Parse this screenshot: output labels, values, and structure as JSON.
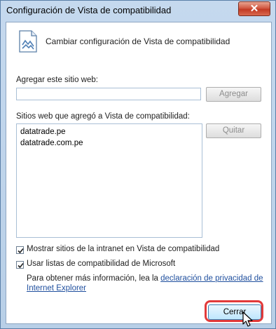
{
  "window": {
    "title": "Configuración de Vista de compatibilidad",
    "close_label": "✕"
  },
  "header": {
    "icon": "compat-view-icon",
    "text": "Cambiar configuración de Vista de compatibilidad"
  },
  "add_site": {
    "label": "Agregar este sitio web:",
    "value": "",
    "button_label": "Agregar"
  },
  "sites": {
    "label": "Sitios web que agregó a Vista de compatibilidad:",
    "items": [
      "datatrade.pe",
      "datatrade.com.pe"
    ],
    "remove_label": "Quitar"
  },
  "options": [
    {
      "label": "Mostrar sitios de la intranet en Vista de compatibilidad",
      "checked": true
    },
    {
      "label": "Usar listas de compatibilidad de Microsoft",
      "checked": true
    }
  ],
  "info": {
    "prefix": "Para obtener más información, lea la ",
    "link_part1": "declaración de privacidad de",
    "link_part2": "Internet Explorer"
  },
  "footer": {
    "close_label": "Cerrar"
  },
  "colors": {
    "highlight": "#e23a3a",
    "link": "#1f4f9e",
    "close_red": "#c23a23"
  }
}
